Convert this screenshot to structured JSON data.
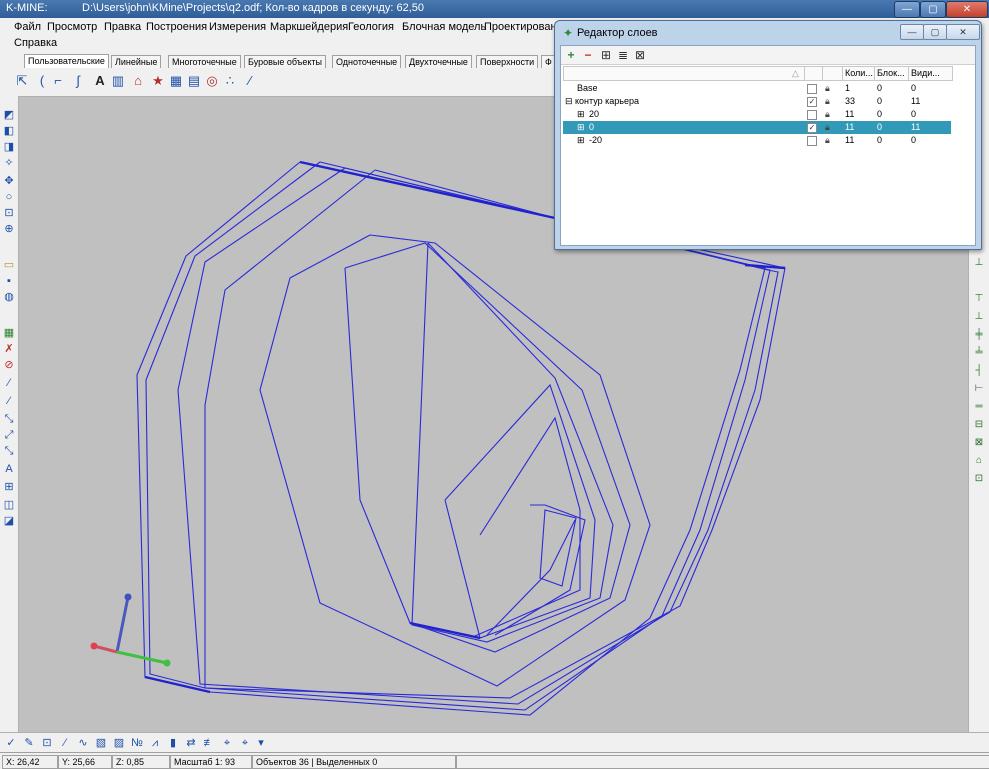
{
  "window": {
    "app_name": "K-MINE:",
    "title_path": "D:\\Users\\john\\KMine\\Projects\\q2.odf; Кол-во кадров в секунду: 62,50",
    "min": "—",
    "max": "▢",
    "close": "✕"
  },
  "menu": {
    "items": [
      "Файл",
      "Просмотр",
      "Правка",
      "Построения",
      "Измерения",
      "Маркшейдерия",
      "Геология",
      "Блочная модель",
      "Проектировани"
    ],
    "help": "Справка"
  },
  "tabs": [
    "Пользовательские",
    "Линейные",
    "Многоточечные",
    "Буровые объекты",
    "Одноточечные",
    "Двухточечные",
    "Поверхности",
    "Ф"
  ],
  "layer_editor": {
    "title": "Редактор слоев",
    "columns": {
      "name": "",
      "sort": "△",
      "count": "Коли...",
      "blocked": "Блок...",
      "visible": "Види..."
    },
    "rows": [
      {
        "tree": "",
        "name": "Base",
        "checked": false,
        "count": "1",
        "blocked": "0",
        "visible": "0",
        "selected": false
      },
      {
        "tree": "⊟",
        "name": "контур карьера",
        "checked": true,
        "count": "33",
        "blocked": "0",
        "visible": "11",
        "selected": false
      },
      {
        "tree": "⊞",
        "name": "20",
        "checked": false,
        "count": "11",
        "blocked": "0",
        "visible": "0",
        "selected": false
      },
      {
        "tree": "⊞",
        "name": "0",
        "checked": true,
        "count": "11",
        "blocked": "0",
        "visible": "11",
        "selected": true
      },
      {
        "tree": "⊞",
        "name": "-20",
        "checked": false,
        "count": "11",
        "blocked": "0",
        "visible": "0",
        "selected": false
      }
    ]
  },
  "status": {
    "x": "X: 26,42",
    "y": "Y: 25,66",
    "z": "Z: 0,85",
    "scale": "Масштаб 1: 93",
    "objects": "Объектов 36 | Выделенных 0"
  },
  "colors": {
    "contour": "#2a2ad8",
    "selection": "#3399b8",
    "background": "#c0c0c0",
    "axis_x": "#e04050",
    "axis_y": "#40c040",
    "axis_z": "#4050c0"
  }
}
